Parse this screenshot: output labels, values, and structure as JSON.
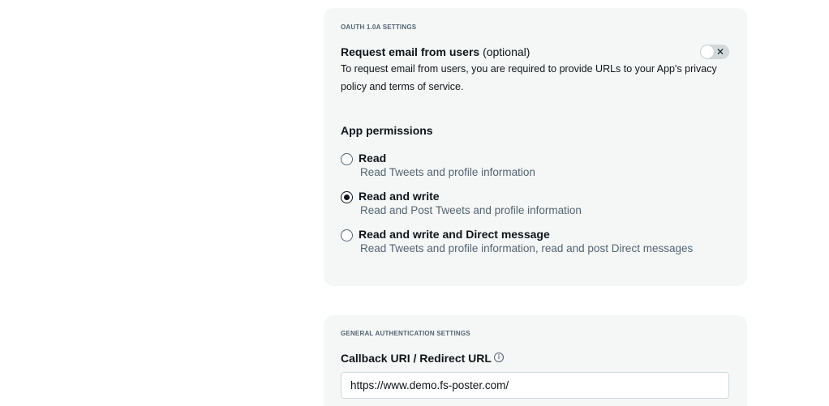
{
  "oauth_section": {
    "label": "OAUTH 1.0A SETTINGS",
    "email": {
      "title": "Request email from users",
      "optional": "(optional)",
      "description": "To request email from users, you are required to provide URLs to your App's privacy policy and terms of service.",
      "enabled": false,
      "toggle_icon": "x-icon"
    },
    "permissions": {
      "heading": "App permissions",
      "options": [
        {
          "label": "Read",
          "description": "Read Tweets and profile information",
          "selected": false
        },
        {
          "label": "Read and write",
          "description": "Read and Post Tweets and profile information",
          "selected": true
        },
        {
          "label": "Read and write and Direct message",
          "description": "Read Tweets and profile information, read and post Direct messages",
          "selected": false
        }
      ]
    }
  },
  "general_section": {
    "label": "GENERAL AUTHENTICATION SETTINGS",
    "callback": {
      "label": "Callback URI / Redirect URL",
      "info_icon": "info-icon",
      "value": "https://www.demo.fs-poster.com/"
    }
  }
}
